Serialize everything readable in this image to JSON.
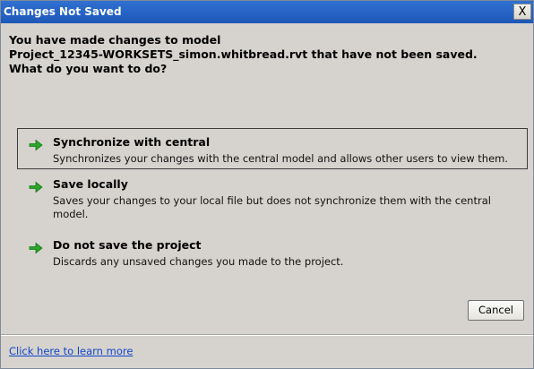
{
  "window": {
    "title": "Changes Not Saved",
    "close_label": "X"
  },
  "message": {
    "line1": "You have made changes to model",
    "line2": "Project_12345-WORKSETS_simon.whitbread.rvt that have not been saved.",
    "line3": "What do you want to do?"
  },
  "options": [
    {
      "icon": "green-arrow-icon",
      "title": "Synchronize with central",
      "description": "Synchronizes your changes with the central model and allows other users to view them."
    },
    {
      "icon": "green-arrow-icon",
      "title": "Save locally",
      "description": "Saves your changes to your local file but does not synchronize them with the central model."
    },
    {
      "icon": "green-arrow-icon",
      "title": "Do not save the project",
      "description": "Discards any unsaved changes you made to the project."
    }
  ],
  "buttons": {
    "cancel_label": "Cancel"
  },
  "footer": {
    "link_text": "Click here to learn more"
  },
  "colors": {
    "titlebar": "#2462c4",
    "dialog_bg": "#d6d3ce",
    "arrow": "#2aa62a",
    "link": "#1144cc"
  }
}
